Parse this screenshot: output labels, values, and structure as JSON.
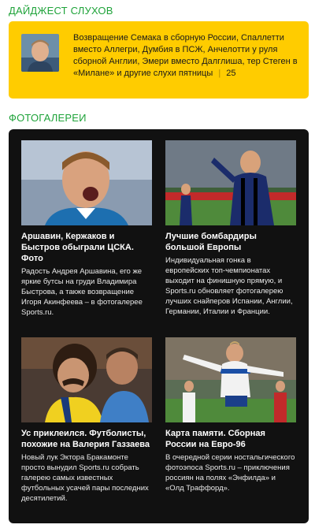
{
  "digest": {
    "title": "Дайджест слухов",
    "text": "Возвращение Семака в сборную России, Спаллетти вместо Аллегри, Думбия в ПСЖ, Анчелотти у руля сборной Англии, Эмери вместо Далглиша, тер Стеген в «Милане» и другие слухи пятницы",
    "separator": "|",
    "comments": "25"
  },
  "galleries": {
    "title": "Фотогалереи",
    "cards": [
      {
        "title": "Аршавин, Кержаков и Быстров обыграли ЦСКА. Фото",
        "text": "Радость Андрея Аршавина, его же яркие бутсы на груди Владимира Быстрова, а также возвращение Игоря Акинфеева – в фотогалерее Sports.ru."
      },
      {
        "title": "Лучшие бомбардиры большой Европы",
        "text": "Индивидуальная гонка в европейских топ-чемпионатах выходит на финишную прямую, и Sports.ru обновляет фотогалерею лучших снайперов Испании, Англии, Германии, Италии и Франции."
      },
      {
        "title": "Ус приклеился. Футболисты, похожие на Валерия Газзаева",
        "text": "Новый лук Эктора Бракамонте просто вынудил Sports.ru собрать галерею самых известных футбольных усачей пары последних десятилетий."
      },
      {
        "title": "Карта памяти. Сборная России на Евро-96",
        "text": "В очередной серии ностальгического фотоэпоса Sports.ru – приключения россиян на полях «Энфилда» и «Олд Траффорд»."
      }
    ]
  },
  "colors": {
    "section_title": "#1fa33a",
    "digest_bg": "#ffcc00",
    "gallery_bg": "#111111"
  }
}
